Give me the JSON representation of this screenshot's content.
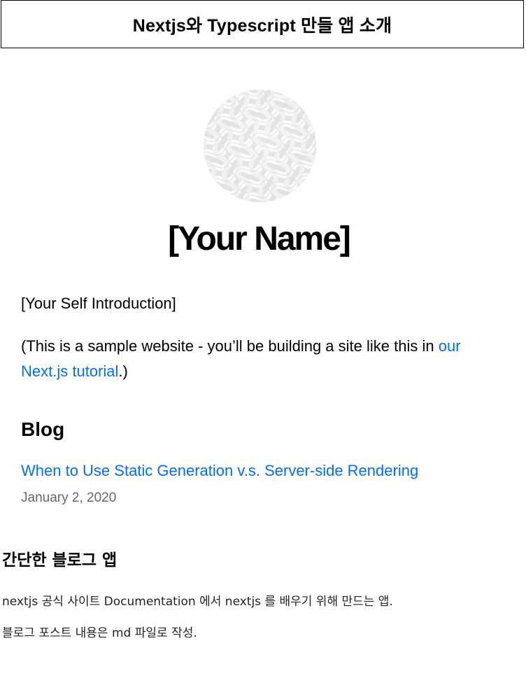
{
  "banner": {
    "title": "Nextjs와 Typescript 만들 앱 소개"
  },
  "profile": {
    "avatar_icon": "woven-pattern-avatar",
    "name": "[Your Name]",
    "self_intro": "[Your Self Introduction]",
    "sample_prefix": "(This is a sample website - you’ll be building a site like this in ",
    "sample_link": "our Next.js tutorial",
    "sample_suffix": ".)"
  },
  "blog": {
    "heading": "Blog",
    "posts": [
      {
        "title": "When to Use Static Generation v.s. Server-side Rendering",
        "date": "January 2, 2020"
      }
    ]
  },
  "about": {
    "heading": "간단한 블로그 앱",
    "line1": "nextjs 공식 사이트 Documentation 에서 nextjs 를 배우기 위해 만드는 앱.",
    "line2": "블로그 포스트 내용은 md 파일로 작성."
  },
  "colors": {
    "link": "#0070f3",
    "muted": "#666666",
    "text": "#000000",
    "background": "#ffffff"
  }
}
